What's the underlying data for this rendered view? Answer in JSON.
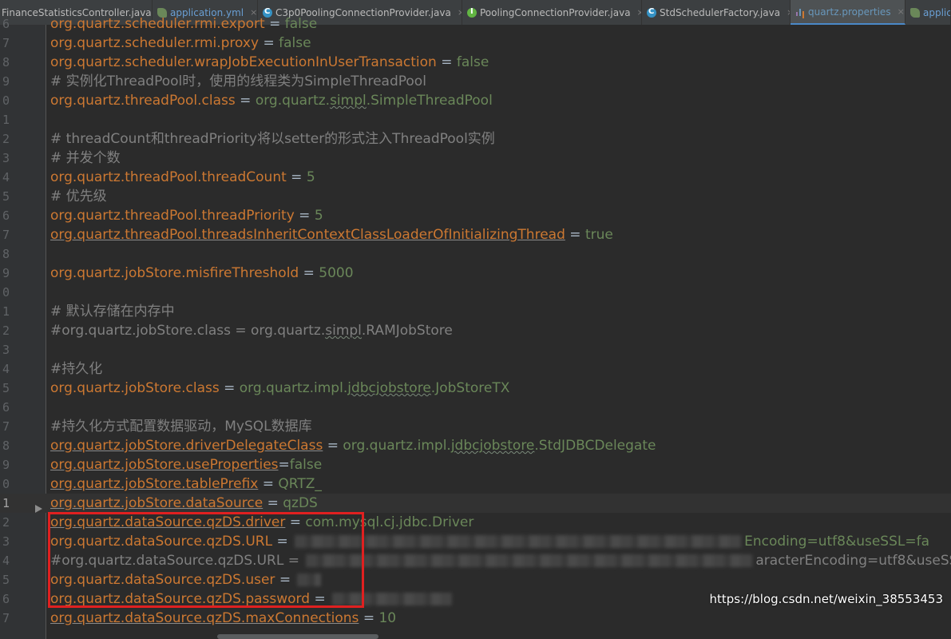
{
  "tabs": [
    {
      "label": "FinanceStatisticsController.java",
      "icon": "class-icon",
      "active": false
    },
    {
      "label": "application.yml",
      "icon": "spring-leaf-icon",
      "active": false
    },
    {
      "label": "C3p0PoolingConnectionProvider.java",
      "icon": "class-icon",
      "active": false
    },
    {
      "label": "PoolingConnectionProvider.java",
      "icon": "interface-icon",
      "active": false
    },
    {
      "label": "StdSchedulerFactory.java",
      "icon": "class-icon",
      "active": false
    },
    {
      "label": "quartz.properties",
      "icon": "properties-file-icon",
      "active": true
    },
    {
      "label": "applic",
      "icon": "spring-leaf-icon",
      "active": false
    }
  ],
  "tab_close_glyph": "×",
  "lines": [
    {
      "n": "6",
      "k": "org.quartz.scheduler.rmi.export",
      "eq": " = ",
      "v": "false"
    },
    {
      "n": "7",
      "k": "org.quartz.scheduler.rmi.proxy",
      "eq": " = ",
      "v": "false"
    },
    {
      "n": "8",
      "k": "org.quartz.scheduler.wrapJobExecutionInUserTransaction",
      "eq": " = ",
      "v": "false"
    },
    {
      "n": "9",
      "c": "# 实例化ThreadPool时，使用的线程类为SimpleThreadPool"
    },
    {
      "n": "0",
      "k": "org.quartz.threadPool.class",
      "eq": " = ",
      "v1": "org.quartz.",
      "w": "simpl",
      "v2": ".SimpleThreadPool"
    },
    {
      "n": "1"
    },
    {
      "n": "2",
      "c": "# threadCount和threadPriority将以setter的形式注入ThreadPool实例"
    },
    {
      "n": "3",
      "c": "# 并发个数"
    },
    {
      "n": "4",
      "k": "org.quartz.threadPool.threadCount",
      "eq": " = ",
      "v": "5"
    },
    {
      "n": "5",
      "c": "# 优先级"
    },
    {
      "n": "6",
      "k": "org.quartz.threadPool.threadPriority",
      "eq": " = ",
      "v": "5"
    },
    {
      "n": "7",
      "u": "org.quartz.threadPool.threadsInheritContextClassLoaderOfInitializingThread",
      "eq": " = ",
      "v": "true"
    },
    {
      "n": "8"
    },
    {
      "n": "9",
      "k": "org.quartz.jobStore.misfireThreshold",
      "eq": " = ",
      "v": "5000"
    },
    {
      "n": "0"
    },
    {
      "n": "1",
      "c": "# 默认存储在内存中"
    },
    {
      "n": "2",
      "c1": "#org.quartz.jobStore.class = org.quartz.",
      "w": "simpl",
      "c2": ".RAMJobStore"
    },
    {
      "n": "3"
    },
    {
      "n": "4",
      "c": "#持久化"
    },
    {
      "n": "5",
      "k": "org.quartz.jobStore.class",
      "eq": " = ",
      "v1": "org.quartz.impl.",
      "w": "jdbcjobstore",
      "v2": ".JobStoreTX"
    },
    {
      "n": "6"
    },
    {
      "n": "7",
      "c": "#持久化方式配置数据驱动，MySQL数据库"
    },
    {
      "n": "8",
      "u": "org.quartz.jobStore.driverDelegateClass",
      "eq": " = ",
      "v1": "org.quartz.impl.",
      "w": "jdbcjobstore",
      "v2": ".StdJDBCDelegate"
    },
    {
      "n": "9",
      "u": "org.quartz.jobStore.useProperties",
      "eq": "=",
      "v": "false"
    },
    {
      "n": "0",
      "u": "org.quartz.jobStore.tablePrefix",
      "eq": " = ",
      "v": "QRTZ_"
    },
    {
      "n": "1",
      "u": "org.quartz.jobStore.dataSource",
      "eq": " = ",
      "v": "qzDS",
      "current": true
    },
    {
      "n": "2",
      "u": "org.quartz.dataSource.qzDS.driver",
      "eq": " = ",
      "v": "com.mysql.cj.jdbc.Driver"
    },
    {
      "n": "3",
      "k": "org.quartz.dataSource.qzDS.URL",
      "eq": " = ",
      "blur": 560,
      "v": "Encoding=utf8&useSSL=fa"
    },
    {
      "n": "4",
      "c1": "#org.quartz.dataSource.qzDS.URL = ",
      "blur": 560,
      "c2": "aracterEncoding=utf8&useSS"
    },
    {
      "n": "5",
      "k": "org.quartz.dataSource.qzDS.user",
      "eq": " = ",
      "blur": 30
    },
    {
      "n": "6",
      "k": "org.quartz.dataSource.qzDS.password",
      "eq": " = ",
      "blur": 150
    },
    {
      "n": "7",
      "u": "org.quartz.dataSource.qzDS.maxConnections",
      "eq": " = ",
      "v": "10"
    }
  ],
  "watermark": "https://blog.csdn.net/weixin_38553453"
}
